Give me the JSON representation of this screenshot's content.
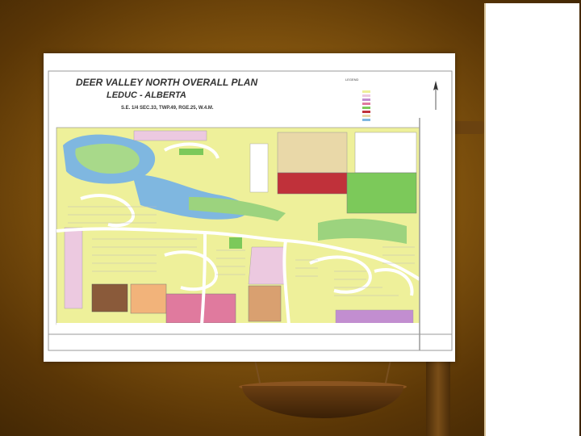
{
  "plan": {
    "title": "DEER VALLEY  NORTH OVERALL PLAN",
    "subtitle": "LEDUC - ALBERTA",
    "legal": "S.E. 1/4 SEC.33, TWP.49, RGE.25, W.4.M.",
    "legend_label": "LEGEND",
    "north_icon": "north-arrow-icon"
  },
  "colors": {
    "background": "#8a5a10",
    "water": "#7fb7e0",
    "park": "#7cc95a",
    "single_family": "#eef09a",
    "semi_detached": "#ecc9e0",
    "multi_family": "#c28ed0",
    "commercial": "#e07a9e",
    "school": "#e9d8a8",
    "church": "#c0313a",
    "brown_parcel": "#8a5a3a",
    "orange_parcel": "#f2b37a",
    "road": "#ffffff"
  }
}
